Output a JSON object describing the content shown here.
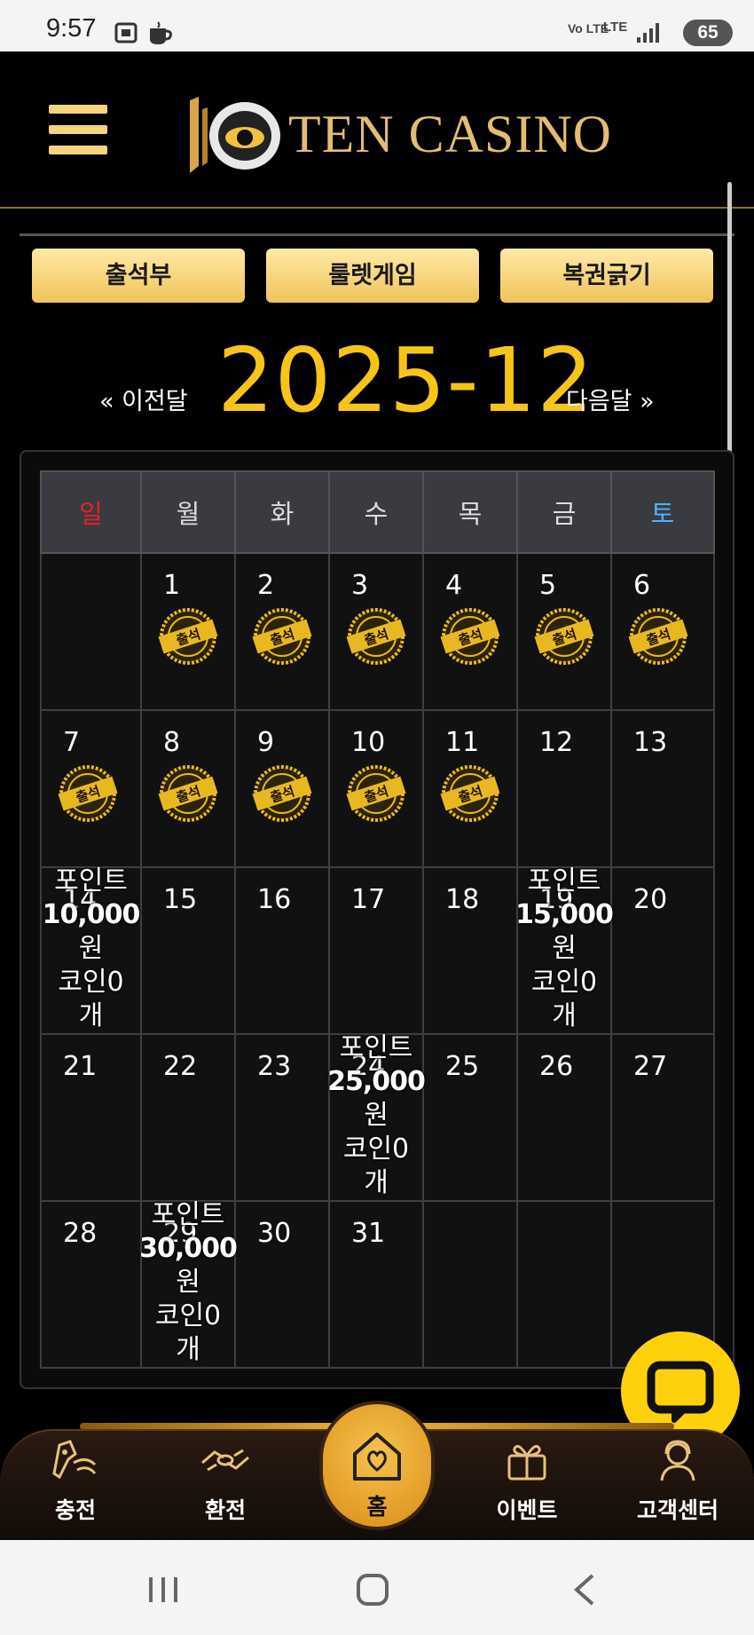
{
  "status_bar": {
    "time": "9:57",
    "network": "LTE",
    "volte": "Vo LTE",
    "battery": "65"
  },
  "header": {
    "logo_text": "TEN CASINO"
  },
  "tabs": [
    {
      "label": "출석부"
    },
    {
      "label": "룰렛게임"
    },
    {
      "label": "복권긁기"
    }
  ],
  "month_nav": {
    "prev": "« 이전달",
    "title": "2025-12",
    "next": "다음달 »"
  },
  "calendar": {
    "weekdays": [
      "일",
      "월",
      "화",
      "수",
      "목",
      "금",
      "토"
    ],
    "weeks": [
      [
        "",
        "1",
        "2",
        "3",
        "4",
        "5",
        "6"
      ],
      [
        "7",
        "8",
        "9",
        "10",
        "11",
        "12",
        "13"
      ],
      [
        "14",
        "15",
        "16",
        "17",
        "18",
        "19",
        "20"
      ],
      [
        "21",
        "22",
        "23",
        "24",
        "25",
        "26",
        "27"
      ],
      [
        "28",
        "29",
        "30",
        "31",
        "",
        "",
        ""
      ]
    ],
    "stamp_label": "출석",
    "rewards": {
      "14": {
        "line1": "포인트",
        "amount": "10,000",
        "unit": "원",
        "coin": "코인0",
        "coin_unit": "개"
      },
      "19": {
        "line1": "포인트",
        "amount": "15,000",
        "unit": "원",
        "coin": "코인0",
        "coin_unit": "개"
      },
      "24": {
        "line1": "포인트",
        "amount": "25,000",
        "unit": "원",
        "coin": "코인0",
        "coin_unit": "개"
      },
      "29": {
        "line1": "포인트",
        "amount": "30,000",
        "unit": "원",
        "coin": "코인0",
        "coin_unit": "개"
      }
    }
  },
  "bottom_nav": {
    "items": [
      {
        "label": "충전",
        "icon": "deposit-icon"
      },
      {
        "label": "환전",
        "icon": "exchange-icon"
      },
      {
        "label": "홈",
        "icon": "home-icon"
      },
      {
        "label": "이벤트",
        "icon": "gift-icon"
      },
      {
        "label": "고객센터",
        "icon": "support-icon"
      }
    ]
  },
  "colors": {
    "accent_gold": "#f5c518",
    "button_gold": "#f0c45a",
    "sunday": "#e02424",
    "saturday": "#4db3ff",
    "chat": "#fdd20b"
  }
}
